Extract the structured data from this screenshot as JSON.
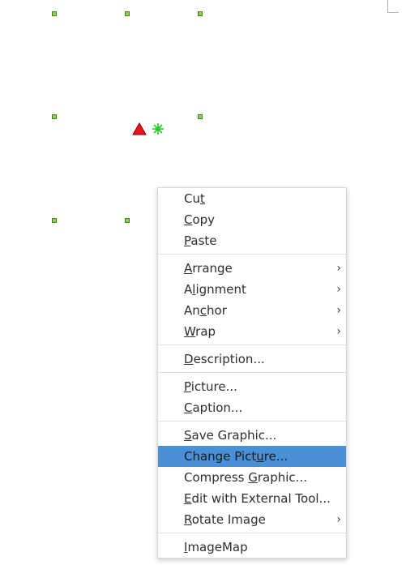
{
  "colors": {
    "handle_fill": "#8fd14f",
    "handle_border": "#4a7a1c",
    "anchor_icon": "#e8141c",
    "rotate_icon": "#22cc22",
    "highlight": "#4a90d9"
  },
  "icons": {
    "anchor": "anchor-triangle-icon",
    "rotate": "rotation-pivot-icon",
    "submenu": "chevron-right-icon"
  },
  "menu": {
    "groups": [
      [
        {
          "pre": "Cu",
          "mn": "t",
          "post": ""
        },
        {
          "pre": "",
          "mn": "C",
          "post": "opy"
        },
        {
          "pre": "",
          "mn": "P",
          "post": "aste"
        }
      ],
      [
        {
          "pre": "",
          "mn": "A",
          "post": "rrange",
          "submenu": true
        },
        {
          "pre": "A",
          "mn": "l",
          "post": "ignment",
          "submenu": true
        },
        {
          "pre": "An",
          "mn": "c",
          "post": "hor",
          "submenu": true
        },
        {
          "pre": "",
          "mn": "W",
          "post": "rap",
          "submenu": true
        }
      ],
      [
        {
          "pre": "",
          "mn": "D",
          "post": "escription..."
        }
      ],
      [
        {
          "pre": "",
          "mn": "P",
          "post": "icture..."
        },
        {
          "pre": "",
          "mn": "C",
          "post": "aption..."
        }
      ],
      [
        {
          "pre": "",
          "mn": "S",
          "post": "ave Graphic..."
        },
        {
          "pre": "Change Pict",
          "mn": "u",
          "post": "re...",
          "highlighted": true
        },
        {
          "pre": "Compress ",
          "mn": "G",
          "post": "raphic..."
        },
        {
          "pre": "",
          "mn": "E",
          "post": "dit with External Tool..."
        },
        {
          "pre": "",
          "mn": "R",
          "post": "otate Image",
          "submenu": true
        }
      ],
      [
        {
          "pre": "",
          "mn": "I",
          "post": "mageMap"
        }
      ]
    ],
    "chevron_glyph": "›"
  }
}
